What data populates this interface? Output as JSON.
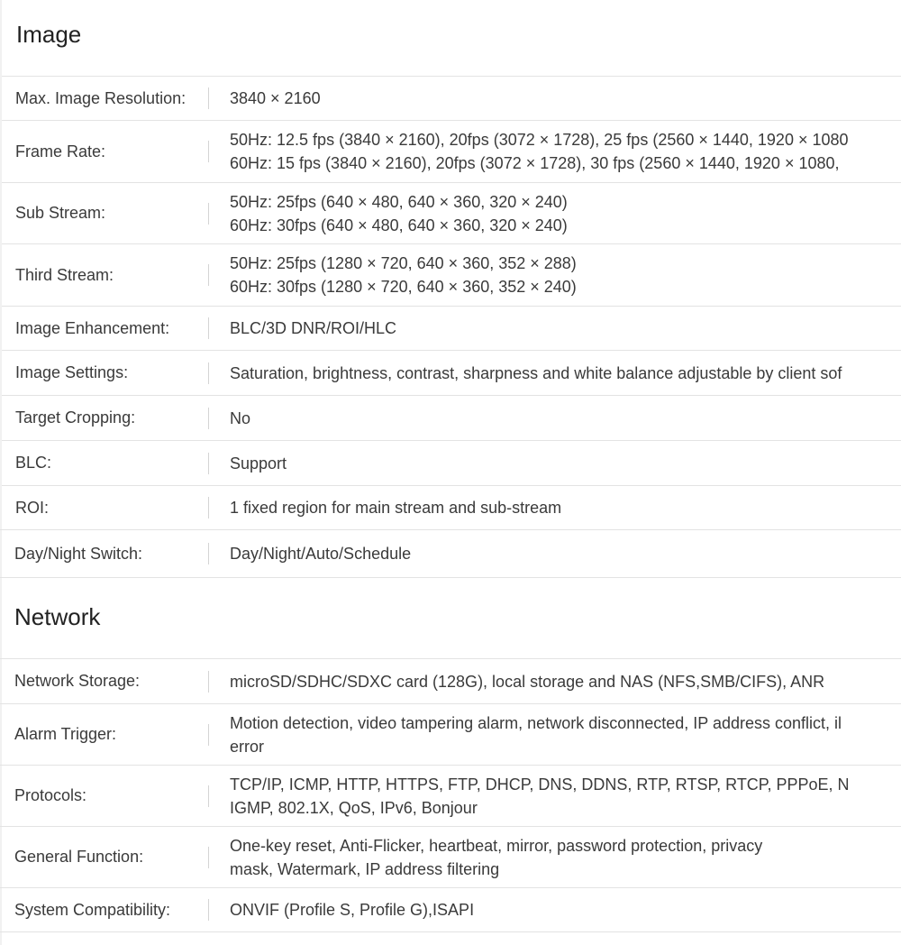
{
  "image": {
    "title": "Image",
    "rows": [
      {
        "label": "Max. Image Resolution:",
        "lines": [
          "3840 × 2160"
        ]
      },
      {
        "label": "Frame Rate:",
        "lines": [
          "50Hz: 12.5 fps (3840 × 2160), 20fps (3072 × 1728), 25 fps (2560 × 1440, 1920 × 1080",
          "60Hz: 15 fps (3840 × 2160), 20fps (3072 × 1728), 30 fps (2560 × 1440, 1920 × 1080,"
        ]
      },
      {
        "label": "Sub Stream:",
        "lines": [
          "50Hz: 25fps (640 × 480, 640 × 360, 320 × 240)",
          "60Hz: 30fps (640 × 480, 640 × 360, 320 × 240)"
        ]
      },
      {
        "label": "Third Stream:",
        "lines": [
          "50Hz: 25fps (1280 × 720, 640 × 360, 352 × 288)",
          "60Hz: 30fps (1280 × 720, 640 × 360, 352 × 240)"
        ]
      },
      {
        "label": "Image Enhancement:",
        "lines": [
          "BLC/3D DNR/ROI/HLC"
        ]
      },
      {
        "label": "Image Settings:",
        "lines": [
          "Saturation, brightness, contrast, sharpness and white balance adjustable by client sof"
        ]
      },
      {
        "label": "Target Cropping:",
        "lines": [
          "No"
        ]
      },
      {
        "label": "BLC:",
        "lines": [
          "Support"
        ]
      },
      {
        "label": "ROI:",
        "lines": [
          "1 fixed region for main stream and sub-stream"
        ]
      },
      {
        "label": "Day/Night Switch:",
        "lines": [
          "Day/Night/Auto/Schedule"
        ]
      }
    ]
  },
  "network": {
    "title": "Network",
    "rows": [
      {
        "label": "Network Storage:",
        "lines": [
          "microSD/SDHC/SDXC card (128G), local storage and NAS (NFS,SMB/CIFS), ANR"
        ]
      },
      {
        "label": "Alarm Trigger:",
        "lines": [
          "Motion detection, video tampering alarm, network disconnected, IP address conflict, il",
          "error"
        ]
      },
      {
        "label": "Protocols:",
        "lines": [
          "TCP/IP, ICMP, HTTP, HTTPS, FTP, DHCP, DNS, DDNS, RTP, RTSP, RTCP, PPPoE, N",
          "IGMP, 802.1X, QoS, IPv6, Bonjour"
        ]
      },
      {
        "label": "General Function:",
        "lines": [
          "One-key reset, Anti-Flicker, heartbeat, mirror, password protection, privacy",
          "mask, Watermark, IP address filtering"
        ]
      },
      {
        "label": "System Compatibility:",
        "lines": [
          "ONVIF (Profile S, Profile G),ISAPI"
        ]
      }
    ]
  }
}
